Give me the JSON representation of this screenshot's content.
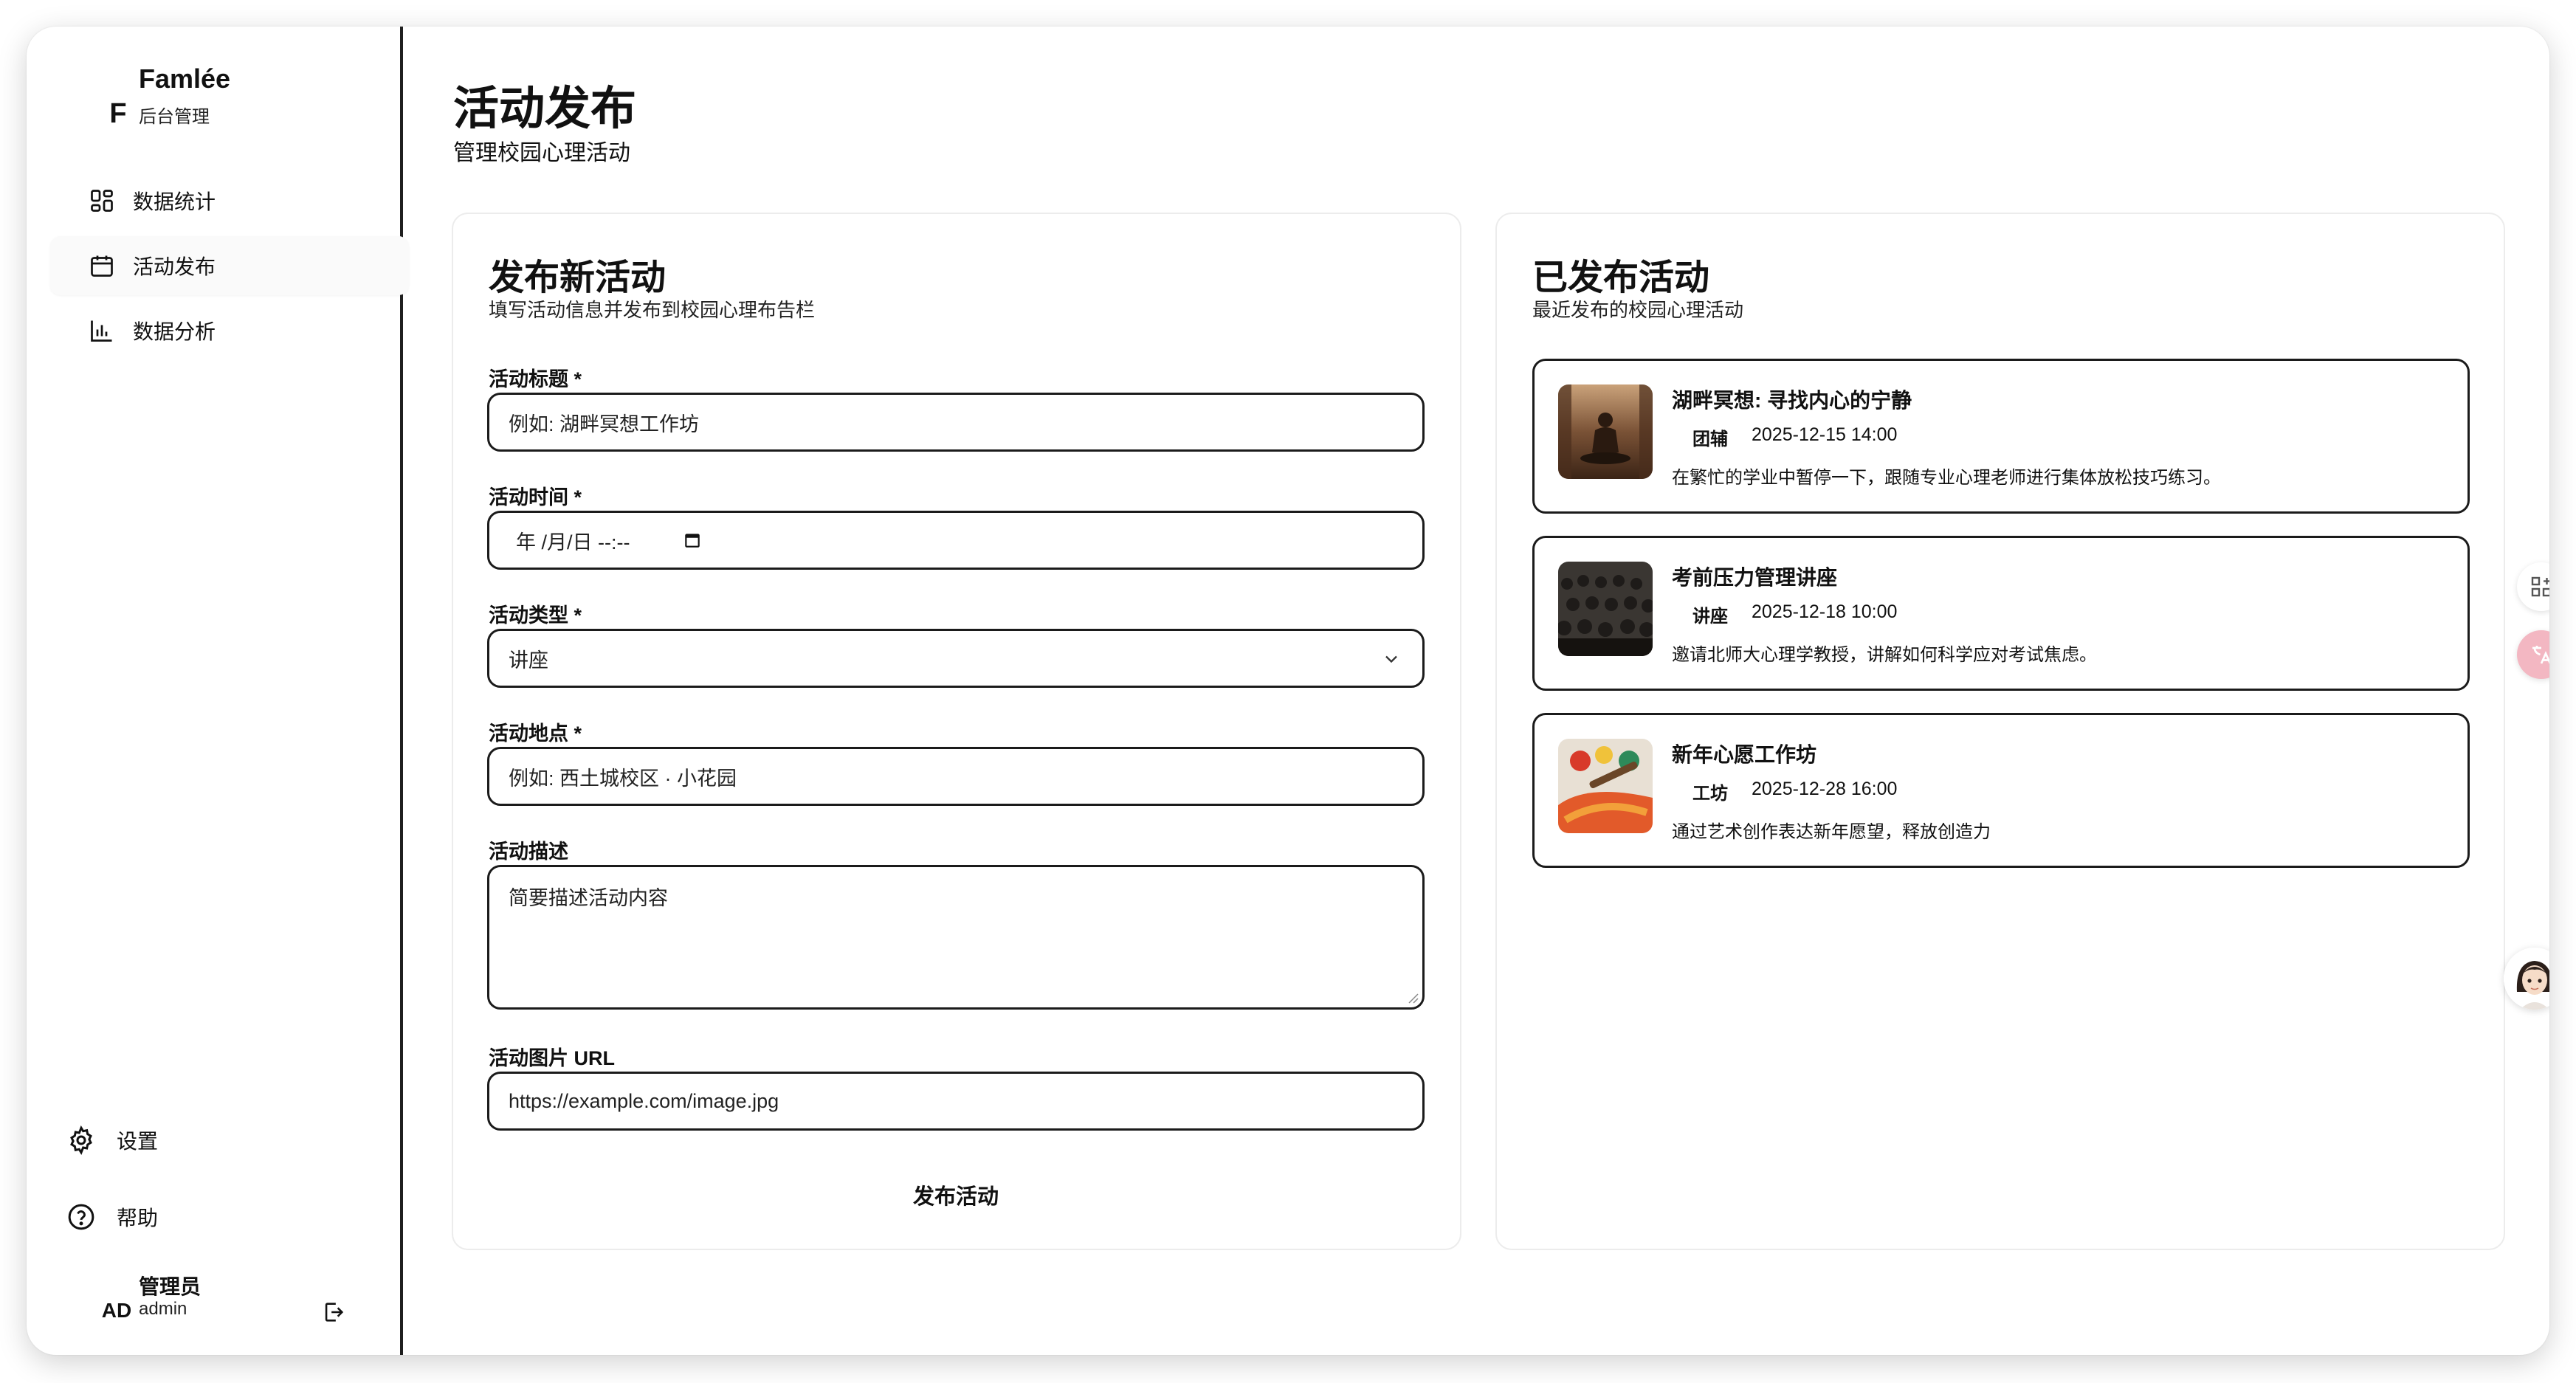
{
  "brand": {
    "initial": "F",
    "name": "Famlée",
    "subtitle": "后台管理"
  },
  "nav": [
    {
      "label": "数据统计",
      "icon": "dashboard-grid-icon",
      "active": false
    },
    {
      "label": "活动发布",
      "icon": "calendar-icon",
      "active": true
    },
    {
      "label": "数据分析",
      "icon": "bar-chart-icon",
      "active": false
    }
  ],
  "sidebar_bottom": {
    "settings": "设置",
    "help": "帮助"
  },
  "user": {
    "initials": "AD",
    "name": "管理员",
    "role": "admin"
  },
  "page": {
    "title": "活动发布",
    "subtitle": "管理校园心理活动"
  },
  "form": {
    "title": "发布新活动",
    "description": "填写活动信息并发布到校园心理布告栏",
    "title_label": "活动标题 *",
    "title_placeholder": "例如: 湖畔冥想工作坊",
    "time_label": "活动时间 *",
    "time_placeholder": "年 /月/日 --:--",
    "type_label": "活动类型 *",
    "type_value": "讲座",
    "location_label": "活动地点 *",
    "location_placeholder": "例如: 西土城校区 · 小花园",
    "desc_label": "活动描述",
    "desc_placeholder": "简要描述活动内容",
    "image_label": "活动图片 URL",
    "image_placeholder": "https://example.com/image.jpg",
    "submit": "发布活动"
  },
  "published": {
    "title": "已发布活动",
    "description": "最近发布的校园心理活动",
    "items": [
      {
        "title": "湖畔冥想: 寻找内心的宁静",
        "type": "团辅",
        "time": "2025-12-15 14:00",
        "desc": "在繁忙的学业中暂停一下，跟随专业心理老师进行集体放松技巧练习。",
        "thumb": "meditation-photo"
      },
      {
        "title": "考前压力管理讲座",
        "type": "讲座",
        "time": "2025-12-18 10:00",
        "desc": "邀请北师大心理学教授，讲解如何科学应对考试焦虑。",
        "thumb": "lecture-audience-photo"
      },
      {
        "title": "新年心愿工作坊",
        "type": "工坊",
        "time": "2025-12-28 16:00",
        "desc": "通过艺术创作表达新年愿望，释放创造力",
        "thumb": "paint-brushes-photo"
      }
    ]
  },
  "floating": {
    "grid_icon": "qr-grid-icon",
    "translate_icon": "translate-icon",
    "assistant": "assistant-avatar"
  }
}
